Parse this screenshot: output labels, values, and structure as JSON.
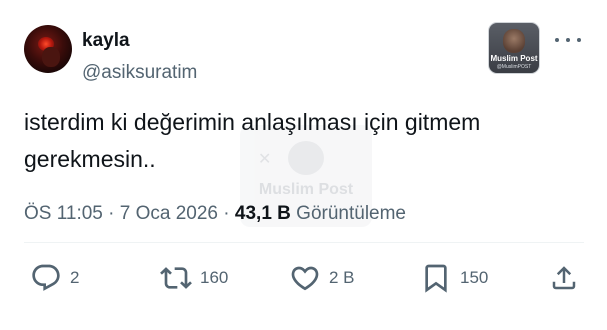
{
  "author": {
    "name": "kayla",
    "handle": "@asiksuratim"
  },
  "badge": {
    "name": "Muslim Post",
    "handle": "@MuslimPOST"
  },
  "watermark": {
    "text": "Muslim Post"
  },
  "tweet": {
    "text_line1": "isterdim ki değerimin anlaşılması için gitmem",
    "text_line2": "gerekmesin.."
  },
  "meta": {
    "time": "ÖS 11:05",
    "separator1": " · ",
    "date": "7 Oca 2026",
    "separator2": " · ",
    "views_count": "43,1 B",
    "views_label": " Görüntüleme"
  },
  "actions": {
    "replies": "2",
    "retweets": "160",
    "likes": "2 B",
    "bookmarks": "150"
  },
  "icons": {
    "more": "more-horizontal-icon",
    "reply": "reply-icon",
    "retweet": "retweet-icon",
    "like": "heart-icon",
    "bookmark": "bookmark-icon",
    "share": "share-icon"
  },
  "colors": {
    "text_primary": "#0f1419",
    "text_secondary": "#536471",
    "background": "#ffffff"
  }
}
